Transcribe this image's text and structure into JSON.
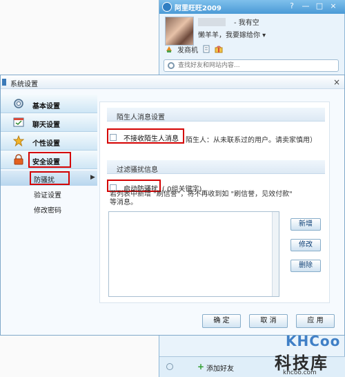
{
  "chat_window": {
    "title": "阿里旺旺2009",
    "status": "- 我有空",
    "signature": "懒羊羊，我要嫁给你 ▾",
    "merchant_label": "发商机",
    "search_placeholder": "查找好友和网站内容...",
    "add_friend": "添加好友",
    "window_buttons": {
      "help": "?",
      "minimize": "—",
      "maximize": "□",
      "close": "×"
    }
  },
  "settings_window": {
    "title": "系统设置",
    "close": "×",
    "nav": [
      {
        "label": "基本设置",
        "icon": "gear-icon"
      },
      {
        "label": "聊天设置",
        "icon": "chat-icon"
      },
      {
        "label": "个性设置",
        "icon": "star-icon"
      },
      {
        "label": "安全设置",
        "icon": "lock-icon"
      }
    ],
    "sub_nav": [
      {
        "label": "防骚扰",
        "active": true
      },
      {
        "label": "验证设置",
        "active": false
      },
      {
        "label": "修改密码",
        "active": false
      }
    ],
    "sub_arrow": "▶",
    "stranger_section": {
      "title": "陌生人消息设置",
      "checkbox_label": "不接收陌生人消息",
      "description": "陌生人：从未联系过的用户。请卖家慎用）",
      "checked": false
    },
    "filter_section": {
      "title": "过滤骚扰信息",
      "checkbox_label": "启动防骚扰",
      "keyword_count": "( 0组关键字)",
      "description": "若列表中新增 \"刷信誉\"，将不再收到如 \"刷信誉，见效付款\" 等消息。",
      "checked": false,
      "keywords": []
    },
    "side_buttons": {
      "add": "新增",
      "edit": "修改",
      "delete": "删除"
    },
    "footer_buttons": {
      "ok": "确 定",
      "cancel": "取 消",
      "apply": "应 用"
    }
  },
  "watermark": {
    "logo_text": "KHCoo",
    "chinese": "科技库",
    "url": "khcoo.com"
  },
  "colors": {
    "titlebar_blue": "#4a9ad6",
    "highlight_red": "#d40000",
    "button_text_blue": "#0a3d74",
    "nav_gradient_end": "#cfe6f5"
  }
}
